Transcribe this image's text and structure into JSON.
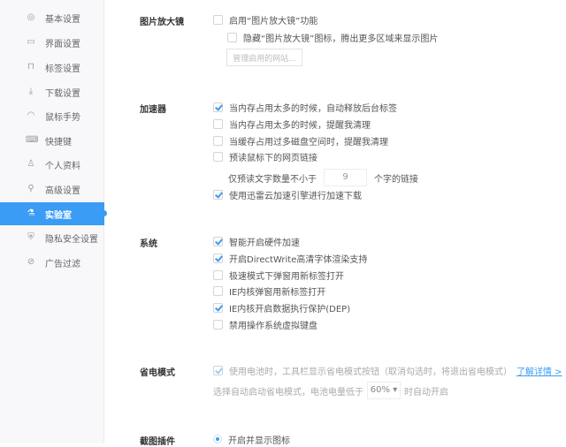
{
  "sidebar": {
    "items": [
      {
        "label": "基本设置",
        "icon": "◎"
      },
      {
        "label": "界面设置",
        "icon": "▭"
      },
      {
        "label": "标签设置",
        "icon": "⊓"
      },
      {
        "label": "下载设置",
        "icon": "⤓"
      },
      {
        "label": "鼠标手势",
        "icon": "◠"
      },
      {
        "label": "快捷键",
        "icon": "⌨"
      },
      {
        "label": "个人资料",
        "icon": "♙"
      },
      {
        "label": "高级设置",
        "icon": "⚲"
      },
      {
        "label": "实验室",
        "icon": "⚗"
      },
      {
        "label": "隐私安全设置",
        "icon": "⛨"
      },
      {
        "label": "广告过滤",
        "icon": "⊘"
      }
    ],
    "active": "实验室"
  },
  "magnifier": {
    "title": "图片放大镜",
    "enable": "启用“图片放大镜”功能",
    "hide_icon": "隐藏“图片放大镜”图标，腾出更多区域来显示图片",
    "manage_button": "管理启用的网站..."
  },
  "accelerator": {
    "title": "加速器",
    "items": [
      {
        "label": "当内存占用太多的时候，自动释放后台标签",
        "checked": true
      },
      {
        "label": "当内存占用太多的时候，提醒我清理",
        "checked": false
      },
      {
        "label": "当缓存占用过多磁盘空间时，提醒我清理",
        "checked": false
      },
      {
        "label": "预读鼠标下的网页链接",
        "checked": false
      }
    ],
    "preread_prefix": "仅预读文字数量不小于",
    "preread_value": "9",
    "preread_suffix": "个字的链接",
    "xunlei": "使用迅雷云加速引擎进行加速下载"
  },
  "system": {
    "title": "系统",
    "items": [
      {
        "label": "智能开启硬件加速",
        "checked": true
      },
      {
        "label": "开启DirectWrite高清字体渲染支持",
        "checked": true
      },
      {
        "label": "极速模式下弹窗用新标签打开",
        "checked": false
      },
      {
        "label": "IE内核弹窗用新标签打开",
        "checked": false
      },
      {
        "label": "IE内核开启数据执行保护(DEP)",
        "checked": true
      },
      {
        "label": "禁用操作系统虚拟键盘",
        "checked": false
      }
    ]
  },
  "power": {
    "title": "省电模式",
    "toolbar_label": "使用电池时，工具栏显示省电模式按钮（取消勾选时，将退出省电模式）",
    "learn_more": "了解详情 >",
    "auto_prefix": "选择自动启动省电模式，电池电量低于",
    "auto_value": "60%",
    "auto_suffix": "时自动开启"
  },
  "screenshot": {
    "title": "截图插件",
    "option": "开启并显示图标"
  }
}
